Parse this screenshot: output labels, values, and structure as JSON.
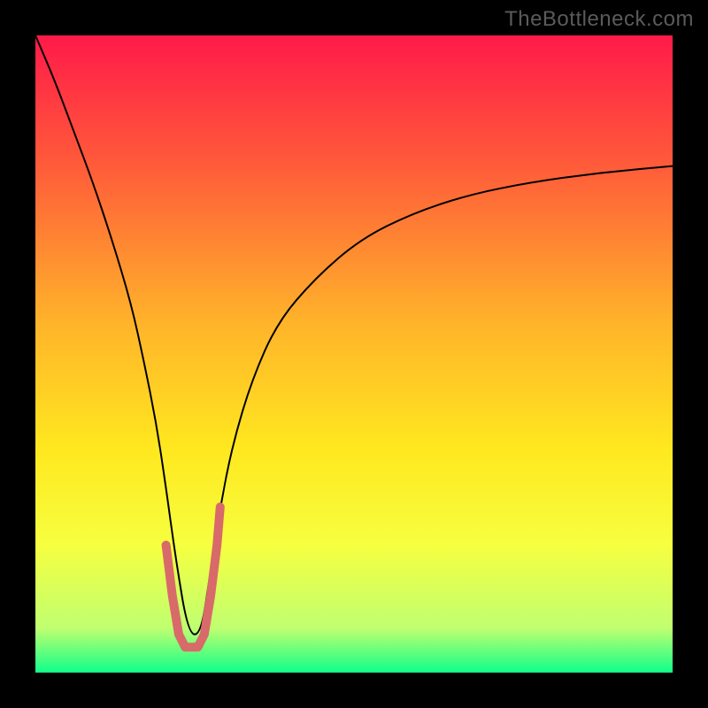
{
  "watermark": "TheBottleneck.com",
  "chart_data": {
    "type": "line",
    "title": "",
    "xlabel": "",
    "ylabel": "",
    "xlim": [
      0,
      100
    ],
    "ylim": [
      0,
      100
    ],
    "background_gradient": {
      "stops": [
        {
          "pos": 0.0,
          "color": "#ff1a49"
        },
        {
          "pos": 0.2,
          "color": "#ff5a3a"
        },
        {
          "pos": 0.45,
          "color": "#ffb32a"
        },
        {
          "pos": 0.65,
          "color": "#ffe81f"
        },
        {
          "pos": 0.8,
          "color": "#f6ff40"
        },
        {
          "pos": 0.93,
          "color": "#c0ff70"
        },
        {
          "pos": 1.0,
          "color": "#10ff8a"
        }
      ]
    },
    "series": [
      {
        "name": "bottleneck-curve",
        "color": "#000000",
        "width": 2,
        "x": [
          0,
          3,
          6,
          9,
          12,
          15,
          17,
          19,
          20.5,
          22,
          24,
          26,
          27.5,
          29,
          31,
          34,
          38,
          44,
          51,
          59,
          68,
          78,
          89,
          100
        ],
        "y": [
          100,
          93,
          85,
          77,
          68,
          58,
          49,
          39,
          29,
          18,
          6,
          6,
          16,
          26,
          36,
          46,
          55,
          62,
          68,
          72,
          75,
          77,
          78.5,
          79.5
        ]
      },
      {
        "name": "highlight-segment",
        "color": "#d86a6a",
        "width": 10,
        "linecap": "round",
        "x": [
          20.5,
          21.5,
          22.5,
          23.5,
          24.5,
          25.5,
          26.5,
          27.5,
          28.5,
          29
        ],
        "y": [
          20,
          12,
          6,
          4,
          4,
          4,
          6,
          12,
          20,
          26
        ]
      }
    ]
  }
}
